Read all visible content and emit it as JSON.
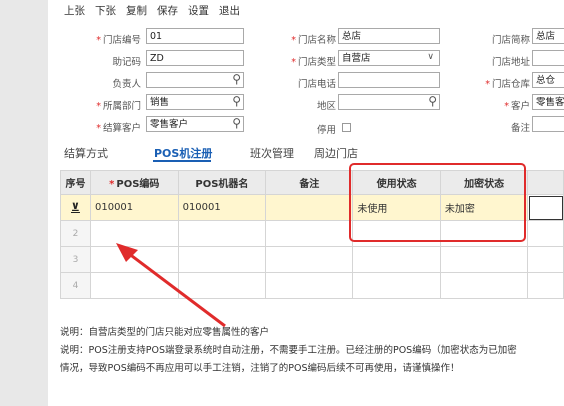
{
  "toolbar": {
    "buttons": [
      "上张",
      "下张",
      "复制",
      "保存",
      "设置",
      "退出"
    ]
  },
  "form": {
    "store_code": {
      "label": "门店编号",
      "value": "01"
    },
    "mnemonic": {
      "label": "助记码",
      "value": "ZD"
    },
    "manager": {
      "label": "负责人",
      "value": ""
    },
    "department": {
      "label": "所属部门",
      "value": "销售"
    },
    "settle_customer": {
      "label": "结算客户",
      "value": "零售客户"
    },
    "store_name": {
      "label": "门店名称",
      "value": "总店"
    },
    "store_type": {
      "label": "门店类型",
      "value": "自营店"
    },
    "store_phone": {
      "label": "门店电话",
      "value": ""
    },
    "region": {
      "label": "地区",
      "value": ""
    },
    "disabled": {
      "label": "停用"
    },
    "store_short": {
      "label": "门店简称",
      "value": "总店"
    },
    "store_address": {
      "label": "门店地址",
      "value": ""
    },
    "store_warehouse": {
      "label": "门店仓库",
      "value": "总仓"
    },
    "customer": {
      "label": "客户",
      "value": "零售客"
    },
    "remarks": {
      "label": "备注",
      "value": ""
    }
  },
  "tabs": [
    "结算方式",
    "POS机注册",
    "班次管理",
    "周边门店"
  ],
  "table": {
    "headers": {
      "seq": "序号",
      "pos_code": "POS编码",
      "pos_name": "POS机器名",
      "remark": "备注",
      "use_status": "使用状态",
      "enc_status": "加密状态"
    },
    "rows": [
      {
        "num": "",
        "pos_code": "010001",
        "pos_name": "010001",
        "remark": "",
        "use_status": "未使用",
        "enc_status": "未加密"
      },
      {
        "num": "2",
        "pos_code": "",
        "pos_name": "",
        "remark": "",
        "use_status": "",
        "enc_status": ""
      },
      {
        "num": "3",
        "pos_code": "",
        "pos_name": "",
        "remark": "",
        "use_status": "",
        "enc_status": ""
      },
      {
        "num": "4",
        "pos_code": "",
        "pos_name": "",
        "remark": "",
        "use_status": "",
        "enc_status": ""
      }
    ],
    "row_marker": "⊻"
  },
  "notes": [
    "说明：自营店类型的门店只能对应零售属性的客户",
    "说明：POS注册支持POS端登录系统时自动注册，不需要手工注册。已经注册的POS编码（加密状态为已加密",
    "情况，导致POS编码不再应用可以手工注销，注销了的POS编码后续不可再使用，请谨慎操作！"
  ],
  "colors": {
    "accent": "#1a5fb4",
    "required": "#e02b2b",
    "annotation": "#e02b2b",
    "selected_row": "#fff6cf"
  }
}
